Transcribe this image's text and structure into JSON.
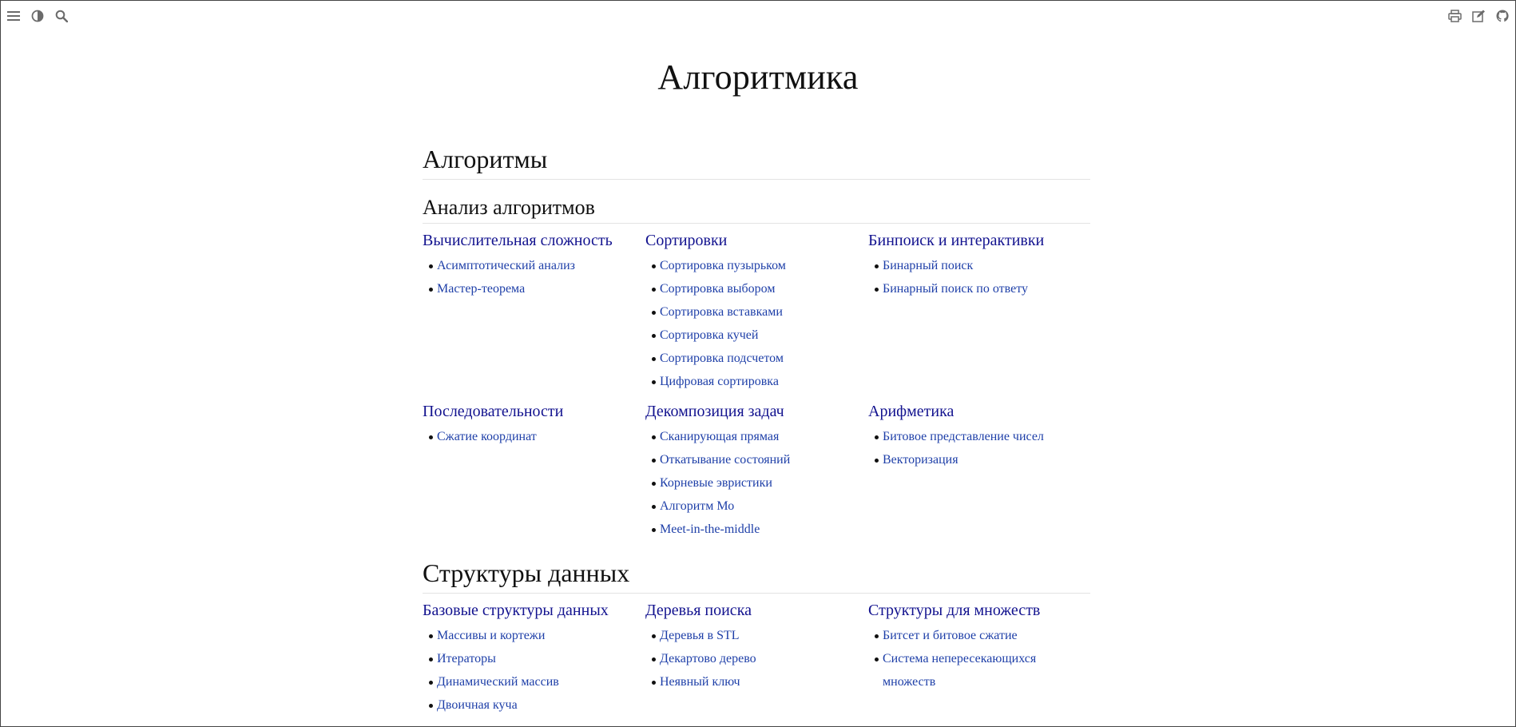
{
  "page_title": "Алгоритмика",
  "sections": [
    {
      "title": "Алгоритмы",
      "subsections": [
        {
          "title": "Анализ алгоритмов",
          "columns": [
            {
              "title": "Вычислительная сложность",
              "items": [
                "Асимптотический анализ",
                "Мастер-теорема"
              ]
            },
            {
              "title": "Сортировки",
              "items": [
                "Сортировка пузырьком",
                "Сортировка выбором",
                "Сортировка вставками",
                "Сортировка кучей",
                "Сортировка подсчетом",
                "Цифровая сортировка"
              ]
            },
            {
              "title": "Бинпоиск и интерактивки",
              "items": [
                "Бинарный поиск",
                "Бинарный поиск по ответу"
              ]
            },
            {
              "title": "Последовательности",
              "items": [
                "Сжатие координат"
              ]
            },
            {
              "title": "Декомпозиция задач",
              "items": [
                "Сканирующая прямая",
                "Откатывание состояний",
                "Корневые эвристики",
                "Алгоритм Мо",
                "Meet-in-the-middle"
              ]
            },
            {
              "title": "Арифметика",
              "items": [
                "Битовое представление чисел",
                "Векторизация"
              ]
            }
          ]
        }
      ]
    },
    {
      "title": "Структуры данных",
      "columns": [
        {
          "title": "Базовые структуры данных",
          "items": [
            "Массивы и кортежи",
            "Итераторы",
            "Динамический массив",
            "Двоичная куча"
          ]
        },
        {
          "title": "Деревья поиска",
          "items": [
            "Деревья в STL",
            "Декартово дерево",
            "Неявный ключ"
          ]
        },
        {
          "title": "Структуры для множеств",
          "items": [
            "Битсет и битовое сжатие",
            "Система непересекающихся множеств"
          ]
        }
      ]
    }
  ],
  "toolbar": {
    "left_icons": [
      "menu-icon",
      "theme-toggle-icon",
      "search-icon"
    ],
    "right_icons": [
      "print-icon",
      "edit-icon",
      "github-icon"
    ]
  }
}
